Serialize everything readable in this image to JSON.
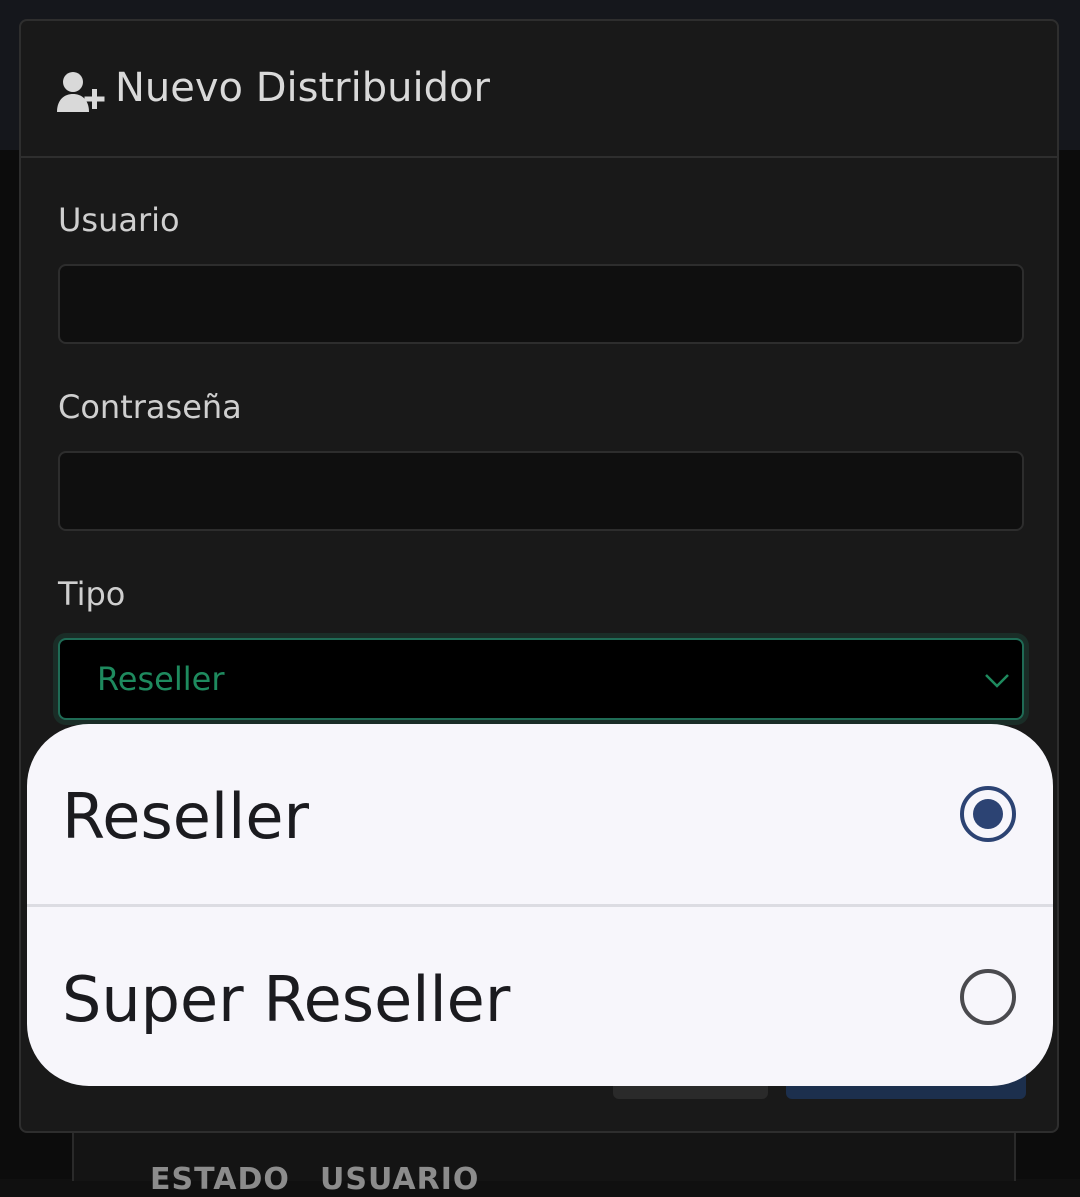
{
  "background": {
    "table_headers": [
      "ESTADO",
      "USUARIO"
    ]
  },
  "modal": {
    "title": "Nuevo Distribuidor",
    "title_icon": "user-plus-icon",
    "fields": {
      "usuario": {
        "label": "Usuario",
        "value": ""
      },
      "contrasena": {
        "label": "Contraseña",
        "value": ""
      },
      "tipo": {
        "label": "Tipo",
        "selected": "Reseller"
      }
    }
  },
  "picker": {
    "options": [
      {
        "label": "Reseller",
        "checked": true
      },
      {
        "label": "Super Reseller",
        "checked": false
      }
    ]
  },
  "colors": {
    "modal_bg": "#191919",
    "select_accent": "#1e8a5e",
    "radio_checked": "#2c4373",
    "picker_bg": "#f7f6fb"
  }
}
